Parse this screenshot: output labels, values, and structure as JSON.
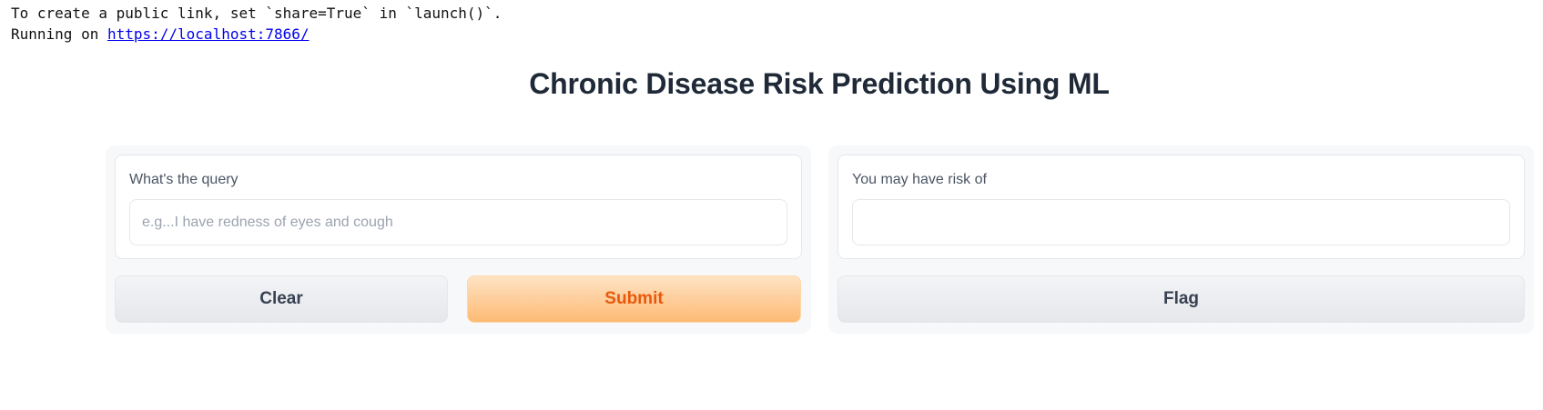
{
  "console": {
    "line1": "To create a public link, set `share=True` in `launch()`.",
    "line2_prefix": "Running on ",
    "url": "https://localhost:7866/"
  },
  "title": "Chronic Disease Risk Prediction Using ML",
  "input_panel": {
    "label": "What's the query",
    "placeholder": "e.g...I have redness of eyes and cough",
    "value": "",
    "clear_label": "Clear",
    "submit_label": "Submit"
  },
  "output_panel": {
    "label": "You may have risk of",
    "value": "",
    "flag_label": "Flag"
  },
  "colors": {
    "primary_text": "#ea580c",
    "primary_bg": "#fdba74",
    "link": "#0000ee"
  }
}
